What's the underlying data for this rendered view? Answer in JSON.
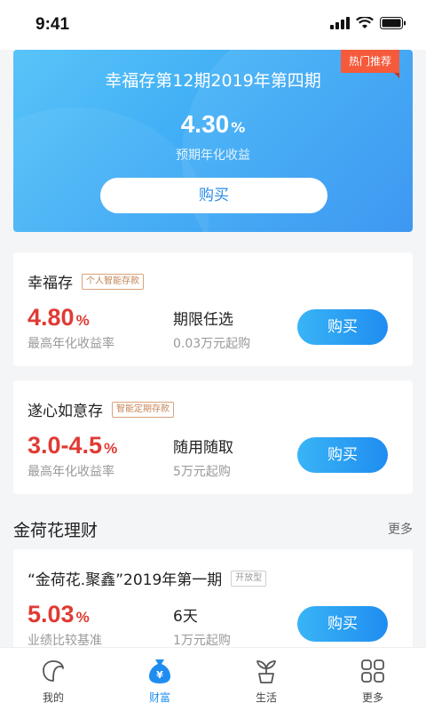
{
  "status_bar": {
    "time": "9:41"
  },
  "hero": {
    "badge": "热门推荐",
    "title": "幸福存第12期2019年第四期",
    "rate": "4.30",
    "rate_unit": "%",
    "rate_label": "预期年化收益",
    "buy_label": "购买"
  },
  "products": [
    {
      "name": "幸福存",
      "tag": "个人智能存款",
      "rate": "4.80",
      "rate_unit": "%",
      "rate_label": "最高年化收益率",
      "term": "期限任选",
      "min_amount": "0.03万元起购",
      "buy_label": "购买"
    },
    {
      "name": "遂心如意存",
      "tag": "智能定期存款",
      "rate": "3.0-4.5",
      "rate_unit": "%",
      "rate_label": "最高年化收益率",
      "term": "随用随取",
      "min_amount": "5万元起购",
      "buy_label": "购买"
    }
  ],
  "section": {
    "title": "金荷花理财",
    "more": "更多"
  },
  "wealth_product": {
    "name": "“金荷花.聚鑫”2019年第一期",
    "tag": "开放型",
    "rate": "5.03",
    "rate_unit": "%",
    "rate_label": "业绩比较基准",
    "term": "6天",
    "min_amount": "1万元起购",
    "buy_label": "购买"
  },
  "tabbar": {
    "active": "财富",
    "items": [
      {
        "label": "我的",
        "icon": "leaf-icon"
      },
      {
        "label": "财富",
        "icon": "money-bag-icon"
      },
      {
        "label": "生活",
        "icon": "plant-icon"
      },
      {
        "label": "更多",
        "icon": "grid-icon"
      }
    ]
  },
  "colors": {
    "accent": "#1f8df0",
    "rate_red": "#e03b34",
    "badge_red": "#f55a3b"
  }
}
